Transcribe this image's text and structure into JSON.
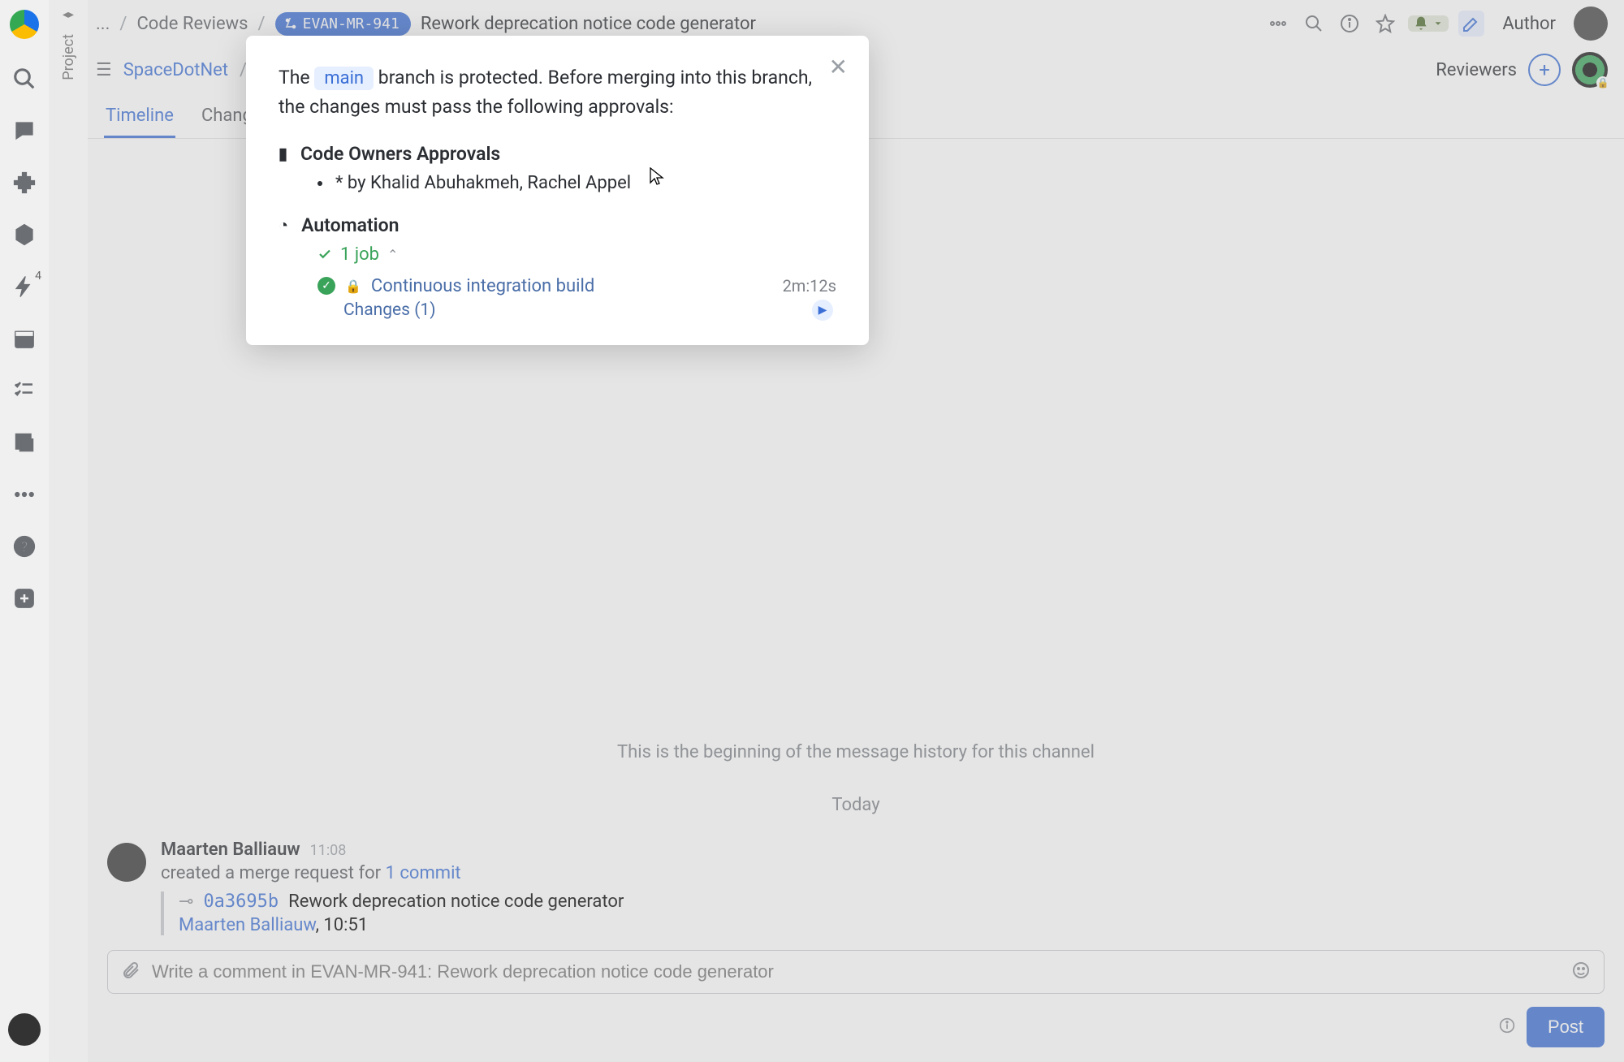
{
  "breadcrumb": {
    "ellipsis": "...",
    "section": "Code Reviews",
    "ticket": "EVAN-MR-941",
    "title": "Rework deprecation notice code generator"
  },
  "header": {
    "author_label": "Author"
  },
  "row2": {
    "repo": "SpaceDotNet",
    "reviewers_label": "Reviewers"
  },
  "tabs": {
    "timeline": "Timeline",
    "changes": "Changes"
  },
  "timeline": {
    "beginning": "This is the beginning of the message history for this channel",
    "day": "Today",
    "msg": {
      "author": "Maarten Balliauw",
      "time": "11:08",
      "action": "created a merge request for",
      "commit_link": "1 commit",
      "commit_hash": "0a3695b",
      "commit_title": "Rework deprecation notice code generator",
      "commit_author": "Maarten Balliauw",
      "commit_time": "10:51"
    }
  },
  "compose": {
    "placeholder": "Write a comment in EVAN-MR-941: Rework deprecation notice code generator",
    "post": "Post"
  },
  "sidebar": {
    "bolt_badge": "4",
    "project": "Project"
  },
  "modal": {
    "intro_pre": "The",
    "branch": "main",
    "intro_post": "branch is protected. Before merging into this branch, the changes must pass the following approvals:",
    "code_owners": "Code Owners Approvals",
    "owners_line": "* by Khalid Abuhakmeh, Rachel Appel",
    "automation": "Automation",
    "jobs": "1 job",
    "build_name": "Continuous integration build",
    "duration": "2m:12s",
    "changes": "Changes (1)"
  }
}
